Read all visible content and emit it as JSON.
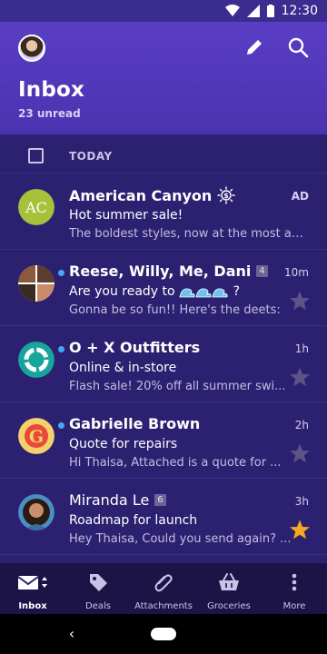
{
  "status_bar": {
    "time": "12:30"
  },
  "header": {
    "title": "Inbox",
    "subtitle": "23 unread"
  },
  "list": {
    "section_label": "TODAY",
    "messages": [
      {
        "sender": "American Canyon",
        "subject": "Hot summer sale!",
        "snippet": "The boldest styles, now at the most adv...",
        "time": "AD",
        "unread": false
      },
      {
        "sender": "Reese, Willy, Me, Dani",
        "count": "4",
        "subject": "Are you ready to",
        "subject_suffix": "?",
        "snippet": "Gonna be so fun!! Here's the deets:",
        "time": "10m",
        "unread": true,
        "starred": false
      },
      {
        "sender": "O + X Outfitters",
        "subject": "Online & in-store",
        "snippet": "Flash sale! 20% off all summer swi...",
        "time": "1h",
        "unread": true,
        "starred": false
      },
      {
        "sender": "Gabrielle Brown",
        "subject": "Quote for repairs",
        "snippet": "Hi Thaisa, Attached is a quote for ...",
        "time": "2h",
        "unread": true,
        "starred": false
      },
      {
        "sender": "Miranda Le",
        "count": "6",
        "subject": "Roadmap for launch",
        "snippet": "Hey Thaisa, Could you send again? ...",
        "time": "3h",
        "unread": false,
        "starred": true
      }
    ]
  },
  "bottom_nav": {
    "items": [
      {
        "label": "Inbox",
        "icon": "inbox-icon"
      },
      {
        "label": "Deals",
        "icon": "tag-icon"
      },
      {
        "label": "Attachments",
        "icon": "paperclip-icon"
      },
      {
        "label": "Groceries",
        "icon": "basket-icon"
      },
      {
        "label": "More",
        "icon": "more-vertical-icon"
      }
    ]
  },
  "colors": {
    "header_bg": "#5a3dc4",
    "list_bg": "#2b2170",
    "unread_dot": "#3fa9f5",
    "star_active": "#f5a623"
  }
}
